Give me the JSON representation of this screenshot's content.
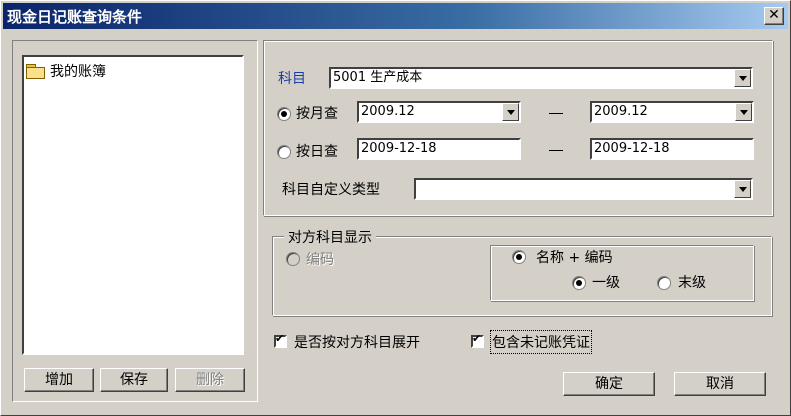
{
  "window": {
    "title": "现金日记账查询条件",
    "close_glyph": "✕"
  },
  "tree": {
    "root_label": "我的账簿"
  },
  "left_buttons": {
    "add": "增加",
    "save": "保存",
    "delete": "删除"
  },
  "subject": {
    "label": "科目",
    "value": "5001 生产成本",
    "label_color": "#1a3ea8"
  },
  "by_month": {
    "label": "按月查",
    "from": "2009.12",
    "to": "2009.12",
    "selected": true
  },
  "by_day": {
    "label": "按日查",
    "from": "2009-12-18",
    "to": "2009-12-18",
    "selected": false
  },
  "separator": "—",
  "custom_type": {
    "label": "科目自定义类型",
    "value": ""
  },
  "counter_group": {
    "title": "对方科目显示",
    "code_only": "编码",
    "name_and_code": "名称 + 编码",
    "level_first": "一级",
    "level_last": "末级"
  },
  "options": {
    "expand_by_counter": {
      "label": "是否按对方科目展开",
      "checked": true
    },
    "include_unposted": {
      "label": "包含未记账凭证",
      "checked": true
    }
  },
  "buttons": {
    "ok": "确定",
    "cancel": "取消"
  }
}
